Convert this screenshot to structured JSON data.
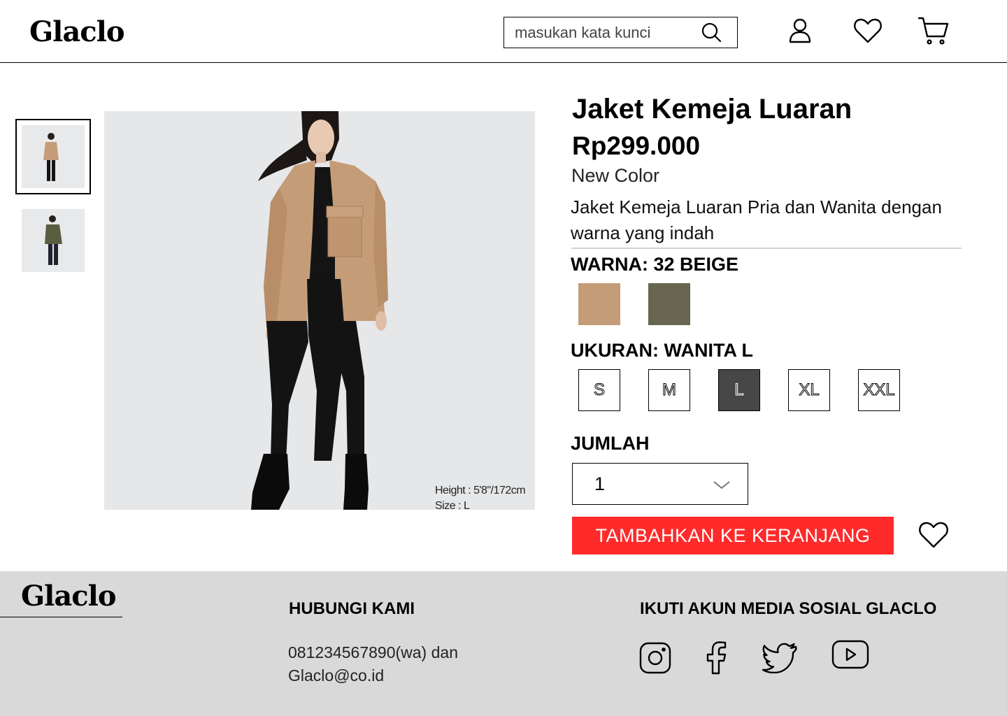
{
  "header": {
    "logo": "Glaclo",
    "search_placeholder": "masukan kata kunci",
    "icons": [
      "search-icon",
      "user-icon",
      "heart-icon",
      "cart-icon"
    ]
  },
  "gallery": {
    "thumbnails": [
      {
        "name": "thumbnail-beige",
        "active": true
      },
      {
        "name": "thumbnail-olive",
        "active": false
      }
    ],
    "photo_caption_line1": "Height : 5'8\"/172cm",
    "photo_caption_line2": "Size : L"
  },
  "product": {
    "title": "Jaket Kemeja Luaran",
    "price": "Rp299.000",
    "subtitle": "New Color",
    "description": "Jaket Kemeja Luaran Pria dan Wanita dengan warna yang indah",
    "color_label": "WARNA: 32 BEIGE",
    "colors": [
      {
        "name": "beige",
        "hex": "#c49d78"
      },
      {
        "name": "olive",
        "hex": "#686650"
      }
    ],
    "size_label": "UKURAN: WANITA L",
    "sizes": [
      "S",
      "M",
      "L",
      "XL",
      "XXL"
    ],
    "selected_size": "L",
    "quantity_label": "JUMLAH",
    "quantity": "1",
    "add_to_cart": "TAMBAHKAN KE KERANJANG"
  },
  "footer": {
    "logo": "Glaclo",
    "contact_heading": "HUBUNGI KAMI",
    "contact_line1": "081234567890(wa) dan",
    "contact_line2": "Glaclo@co.id",
    "social_heading": "IKUTI AKUN MEDIA SOSIAL GLACLO",
    "social_icons": [
      "instagram-icon",
      "facebook-icon",
      "twitter-icon",
      "youtube-icon"
    ]
  },
  "colors": {
    "accent": "#ff2a2a",
    "footer_bg": "#d9d9d9",
    "selected_size_bg": "#474747"
  }
}
